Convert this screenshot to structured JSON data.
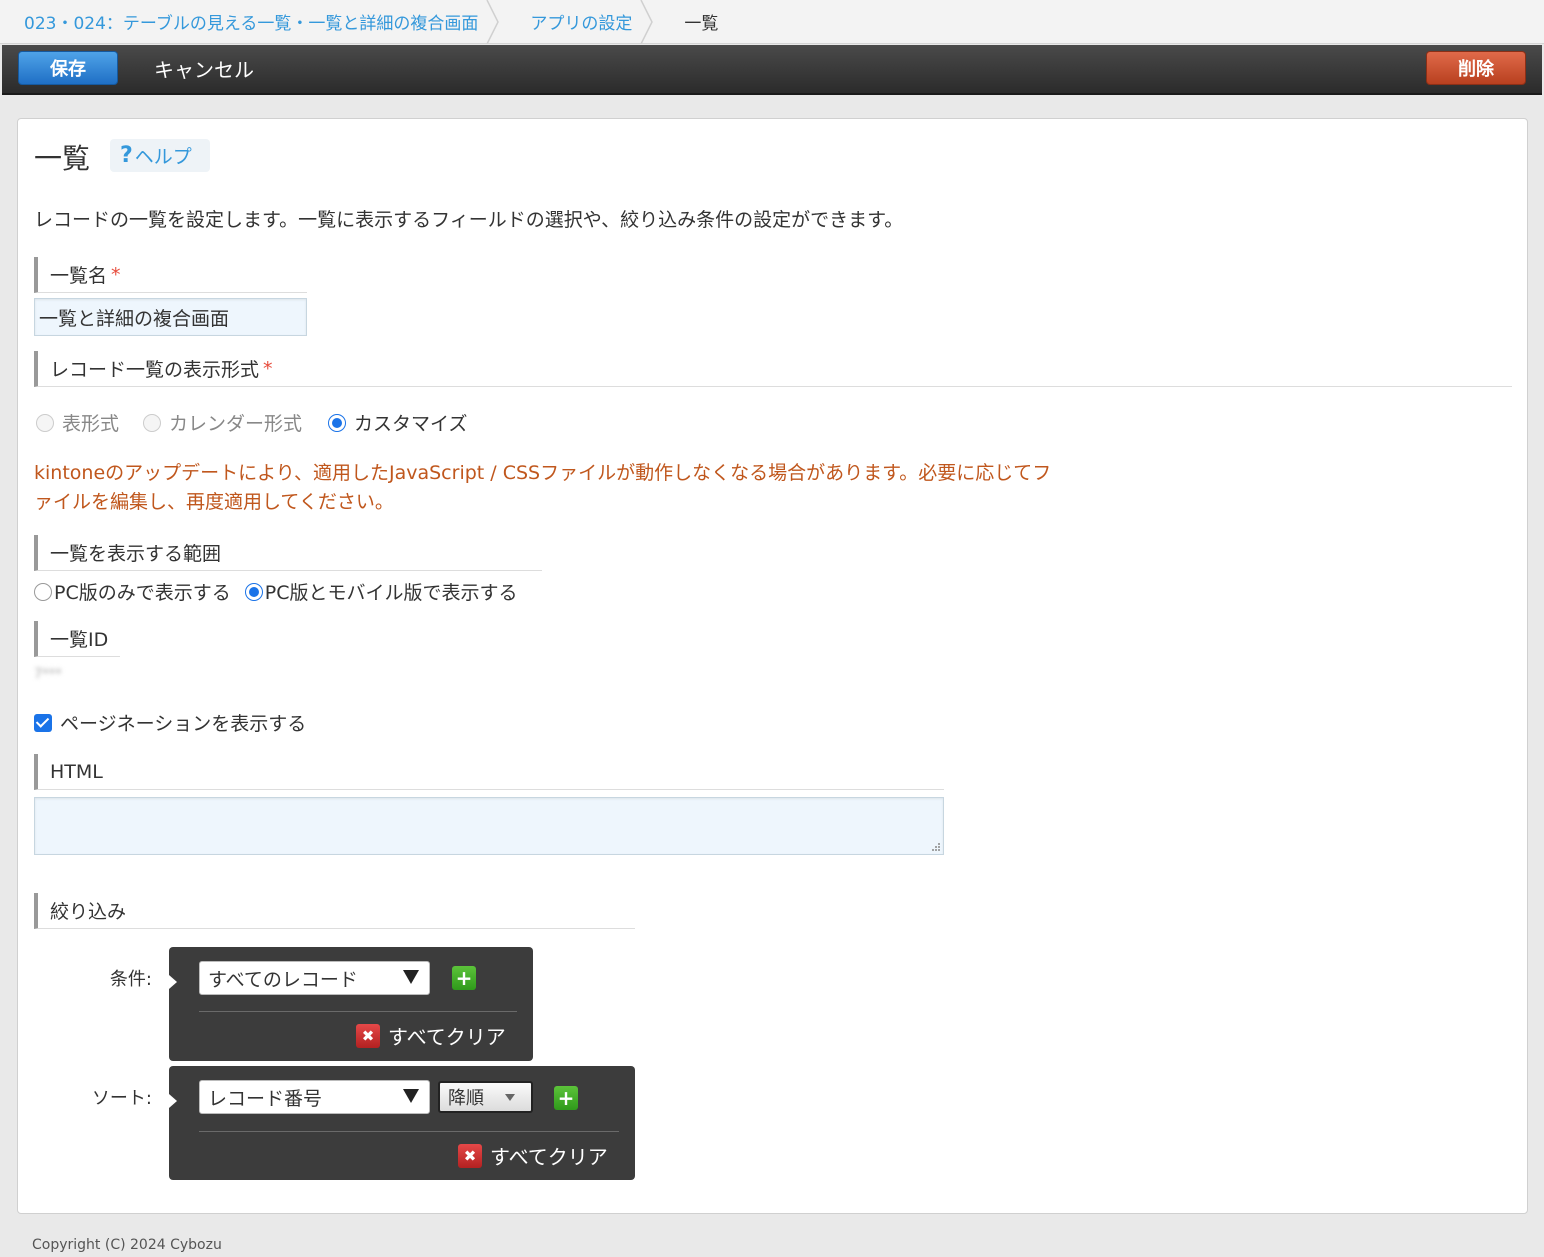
{
  "breadcrumb": {
    "app": "023・024：テーブルの見える一覧・一覧と詳細の複合画面",
    "settings": "アプリの設定",
    "current": "一覧"
  },
  "toolbar": {
    "save_label": "保存",
    "cancel_label": "キャンセル",
    "delete_label": "削除"
  },
  "page": {
    "title": "一覧",
    "help_label": "ヘルプ",
    "description": "レコードの一覧を設定します。一覧に表示するフィールドの選択や、絞り込み条件の設定ができます。"
  },
  "view_name": {
    "label": "一覧名",
    "required_mark": "*",
    "value": "一覧と詳細の複合画面"
  },
  "display_format": {
    "label": "レコード一覧の表示形式",
    "required_mark": "*",
    "options": [
      "表形式",
      "カレンダー形式",
      "カスタマイズ"
    ],
    "selected": "カスタマイズ",
    "warning_line1": "kintoneのアップデートにより、適用したJavaScript / CSSファイルが動作しなくなる場合があります。必要に応じてフ",
    "warning_line2": "ァイルを編集し、再度適用してください。"
  },
  "display_scope": {
    "label": "一覧を表示する範囲",
    "options": [
      "PC版のみで表示する",
      "PC版とモバイル版で表示する"
    ],
    "selected": "PC版とモバイル版で表示する"
  },
  "view_id": {
    "label": "一覧ID",
    "value": "7***"
  },
  "pagination": {
    "label": "ページネーションを表示する",
    "checked": true
  },
  "html": {
    "label": "HTML",
    "value": ""
  },
  "filter": {
    "label": "絞り込み",
    "condition_label": "条件:",
    "condition_value": "すべてのレコード",
    "sort_label": "ソート:",
    "sort_field": "レコード番号",
    "sort_order": "降順",
    "clear_all_label": "すべてクリア",
    "add_icon": "plus-icon",
    "clear_icon": "close-icon"
  },
  "footer": {
    "copyright": "Copyright (C) 2024 Cybozu"
  },
  "colors": {
    "link": "#3498db",
    "save": "#1f6fc5",
    "delete": "#b8401f",
    "warning": "#c0571d",
    "required": "#e74c3c"
  }
}
